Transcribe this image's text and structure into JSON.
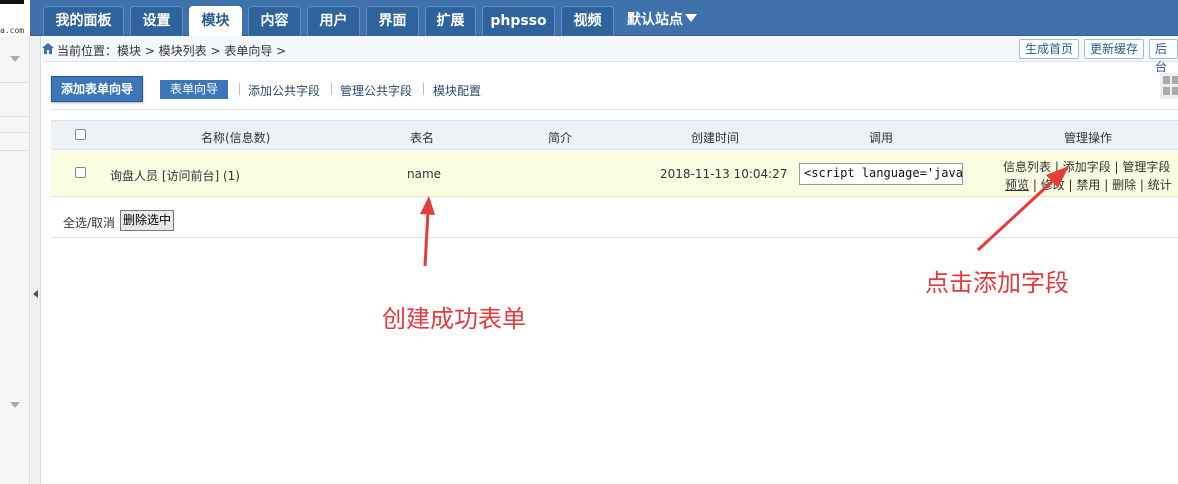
{
  "logo": {
    "text": "a.com"
  },
  "nav": {
    "tabs": [
      {
        "label": "我的面板",
        "active": false
      },
      {
        "label": "设置",
        "active": false
      },
      {
        "label": "模块",
        "active": true
      },
      {
        "label": "内容",
        "active": false
      },
      {
        "label": "用户",
        "active": false
      },
      {
        "label": "界面",
        "active": false
      },
      {
        "label": "扩展",
        "active": false
      },
      {
        "label": "phpsso",
        "active": false
      },
      {
        "label": "视频",
        "active": false
      }
    ],
    "site_label": "默认站点"
  },
  "breadcrumb": {
    "text": "当前位置：模块 > 模块列表 > 表单向导 >"
  },
  "top_actions": {
    "generate_home": "生成首页",
    "update_cache": "更新缓存",
    "backend": "后台"
  },
  "subnav": {
    "primary": "添加表单向导",
    "current": "表单向导",
    "links": [
      "添加公共字段",
      "管理公共字段",
      "模块配置"
    ]
  },
  "table": {
    "headers": {
      "name": "名称(信息数)",
      "table_name": "表名",
      "intro": "简介",
      "created": "创建时间",
      "call": "调用",
      "ops": "管理操作"
    },
    "rows": [
      {
        "name": "询盘人员 [访问前台] (1)",
        "table_name": "name",
        "intro": "",
        "created": "2018-11-13 10:04:27",
        "call_code": "<script language='javascr",
        "ops_line1": [
          "信息列表",
          "添加字段",
          "管理字段"
        ],
        "ops_line2": [
          "预览",
          "修改",
          "禁用",
          "删除",
          "统计"
        ]
      }
    ]
  },
  "footer": {
    "select_all": "全选/取消",
    "delete_selected": "删除选中"
  },
  "annotations": {
    "created_form": "创建成功表单",
    "click_add_field": "点击添加字段"
  },
  "colors": {
    "nav_bg": "#3f72aa",
    "annotation": "#e53b3b",
    "row_highlight": "#fbfde2"
  }
}
